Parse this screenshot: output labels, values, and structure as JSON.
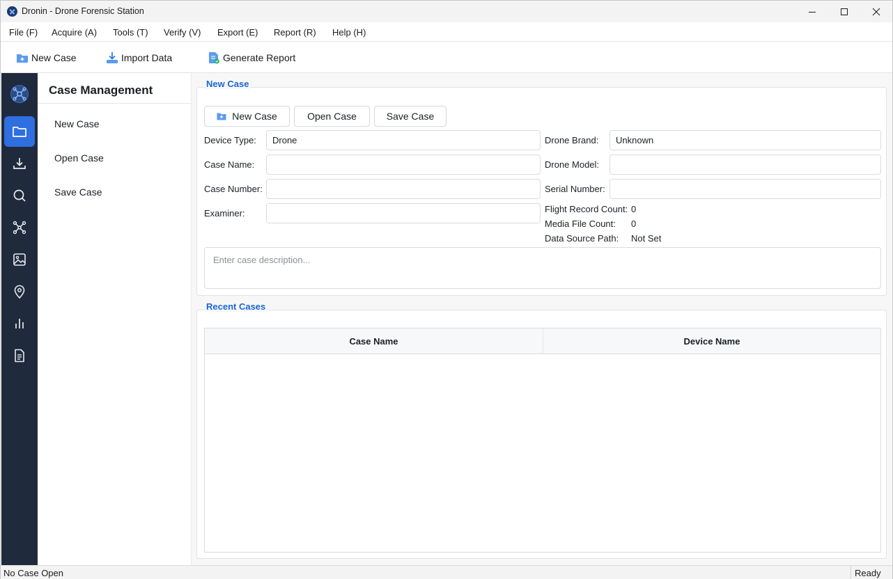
{
  "window": {
    "title": "Dronin - Drone Forensic Station"
  },
  "menu": {
    "items": [
      {
        "label": "File (F)"
      },
      {
        "label": "Acquire (A)"
      },
      {
        "label": "Tools (T)"
      },
      {
        "label": "Verify (V)"
      },
      {
        "label": "Export (E)"
      },
      {
        "label": "Report (R)"
      },
      {
        "label": "Help (H)"
      }
    ]
  },
  "toolbar": {
    "new_case": "New Case",
    "import_data": "Import Data",
    "generate_report": "Generate Report"
  },
  "rail": {
    "items": [
      "drone-logo-icon",
      "folder-icon",
      "download-icon",
      "search-icon",
      "drone-icon",
      "image-icon",
      "location-pin-icon",
      "bar-chart-icon",
      "document-icon"
    ],
    "active": "folder-icon",
    "accent": "#2f6fe0",
    "background": "#1f2a3c"
  },
  "nav": {
    "title": "Case Management",
    "items": [
      {
        "label": "New Case"
      },
      {
        "label": "Open Case"
      },
      {
        "label": "Save Case"
      }
    ]
  },
  "new_case": {
    "group_title": "New Case",
    "buttons": {
      "new": "New Case",
      "open": "Open Case",
      "save": "Save Case"
    },
    "fields": {
      "device_type": {
        "label": "Device Type:",
        "value": "Drone"
      },
      "case_name": {
        "label": "Case Name:",
        "value": ""
      },
      "case_number": {
        "label": "Case Number:",
        "value": ""
      },
      "examiner": {
        "label": "Examiner:",
        "value": ""
      },
      "drone_brand": {
        "label": "Drone Brand:",
        "value": "Unknown"
      },
      "drone_model": {
        "label": "Drone Model:",
        "value": ""
      },
      "serial_number": {
        "label": "Serial Number:",
        "value": ""
      }
    },
    "info": {
      "flight_record_count": {
        "label": "Flight Record Count:",
        "value": "0"
      },
      "media_file_count": {
        "label": "Media File Count:",
        "value": "0"
      },
      "data_source_path": {
        "label": "Data Source Path:",
        "value": "Not Set"
      }
    },
    "description_placeholder": "Enter case description..."
  },
  "recent_cases": {
    "group_title": "Recent Cases",
    "columns": [
      "Case Name",
      "Device Name"
    ],
    "rows": []
  },
  "status": {
    "left": "No Case Open",
    "right": "Ready"
  }
}
